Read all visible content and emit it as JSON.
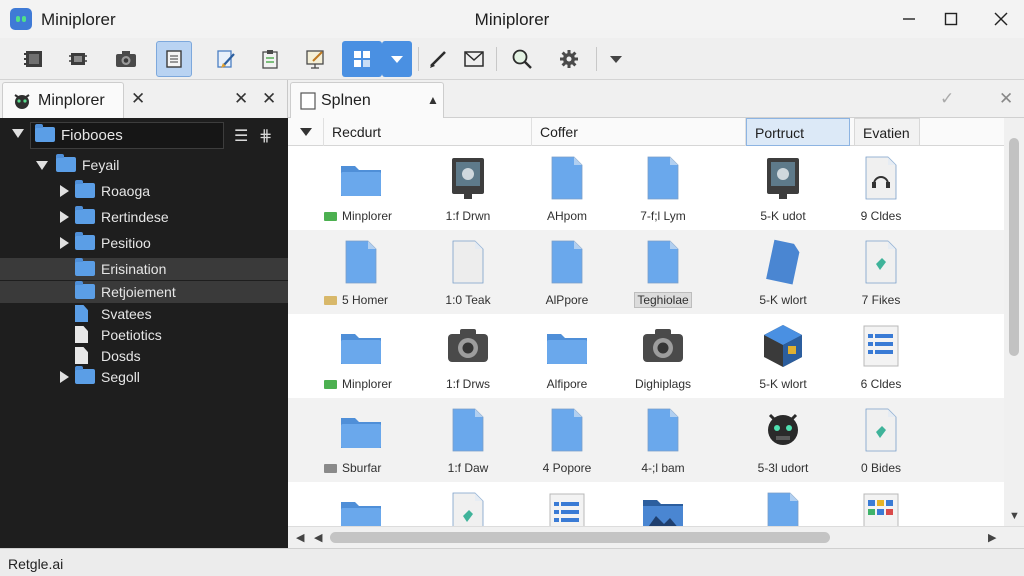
{
  "window": {
    "title_left": "Miniplorer",
    "title_center": "Miniplorer",
    "minimize": "—",
    "maximize": "☐",
    "close": "✕"
  },
  "toolbar": {
    "icons": [
      "film-strip-icon",
      "chip-icon",
      "camera-icon",
      "document-icon",
      "pencil-doc-icon",
      "clipboard-icon",
      "edit-board-icon",
      "puzzle-icon",
      "chevron-down-icon",
      "pen-icon",
      "mail-icon",
      "magnifier-icon",
      "gear-icon",
      "dropdown-arrow-icon"
    ]
  },
  "left_panel": {
    "tab_label": "Minplorer",
    "close_tab": "✕",
    "close_a": "✕",
    "close_b": "✕",
    "tree": [
      {
        "label": "Fiobooes",
        "level": 0,
        "expanded": true,
        "kind": "folder",
        "root": true
      },
      {
        "label": "Feyail",
        "level": 1,
        "expanded": true,
        "kind": "folder"
      },
      {
        "label": "Roaoga",
        "level": 2,
        "expanded": false,
        "kind": "folder"
      },
      {
        "label": "Rertindese",
        "level": 2,
        "expanded": false,
        "kind": "folder"
      },
      {
        "label": "Pesitioo",
        "level": 2,
        "expanded": false,
        "kind": "folder"
      },
      {
        "label": "Erisination",
        "level": 2,
        "kind": "folder",
        "selected": true
      },
      {
        "label": "Retjoiement",
        "level": 2,
        "kind": "folder",
        "selected": true
      },
      {
        "label": "Svatees",
        "level": 2,
        "kind": "doc-blue"
      },
      {
        "label": "Poetiotics",
        "level": 2,
        "kind": "doc"
      },
      {
        "label": "Dosds",
        "level": 2,
        "kind": "doc"
      },
      {
        "label": "Segoll",
        "level": 2,
        "expanded": false,
        "kind": "folder"
      }
    ]
  },
  "right_panel": {
    "tab_label": "Splnen",
    "tab_arrow": "▲",
    "check": "✓",
    "close": "✕",
    "columns": [
      "Recdurt",
      "Coffer",
      "Portruct",
      "Evatien"
    ],
    "rows": [
      [
        {
          "icon": "folder",
          "label": "Minplorer",
          "lead": "green"
        },
        {
          "icon": "monitor",
          "label": "1:f Drwn"
        },
        {
          "icon": "doc-blue",
          "label": "AHpom"
        },
        {
          "icon": "doc-blue",
          "label": "7-f;l Lym"
        },
        {
          "icon": "monitor",
          "label": "5-K udot"
        },
        {
          "icon": "headset-doc",
          "label": "9 Cldes"
        }
      ],
      [
        {
          "icon": "doc-blue",
          "label": "5 Homer",
          "lead": "tan"
        },
        {
          "icon": "doc-white",
          "label": "1:0 Teak"
        },
        {
          "icon": "doc-blue",
          "label": "AlPpore"
        },
        {
          "icon": "doc-blue",
          "label": "Teghiolae",
          "tag": true
        },
        {
          "icon": "doc-tilted",
          "label": "5-K wlort"
        },
        {
          "icon": "doc-teal",
          "label": "7 Fikes"
        }
      ],
      [
        {
          "icon": "folder",
          "label": "Minplorer",
          "lead": "green"
        },
        {
          "icon": "camera",
          "label": "1:f Drws"
        },
        {
          "icon": "folder",
          "label": "Alfipore"
        },
        {
          "icon": "camera",
          "label": "Dighiplags"
        },
        {
          "icon": "box",
          "label": "5-K wlort"
        },
        {
          "icon": "list-doc",
          "label": "6 Cldes"
        }
      ],
      [
        {
          "icon": "folder",
          "label": "Sburfar",
          "lead": "gray"
        },
        {
          "icon": "doc-blue",
          "label": "1:f Daw"
        },
        {
          "icon": "doc-blue",
          "label": "4 Popore"
        },
        {
          "icon": "doc-blue",
          "label": "4-;l bam"
        },
        {
          "icon": "robot",
          "label": "5-3l udort"
        },
        {
          "icon": "doc-teal",
          "label": "0 Bides"
        }
      ],
      [
        {
          "icon": "folder",
          "label": "",
          "lead": "gray"
        },
        {
          "icon": "doc-teal",
          "label": ""
        },
        {
          "icon": "list-doc",
          "label": ""
        },
        {
          "icon": "image-folder",
          "label": ""
        },
        {
          "icon": "doc-blue",
          "label": ""
        },
        {
          "icon": "grid-doc",
          "label": ""
        }
      ]
    ]
  },
  "status": {
    "text": "Retgle.ai"
  },
  "colors": {
    "accent": "#4a90e2",
    "tree_bg": "#1e1e1e",
    "folder": "#5b9ee6"
  }
}
